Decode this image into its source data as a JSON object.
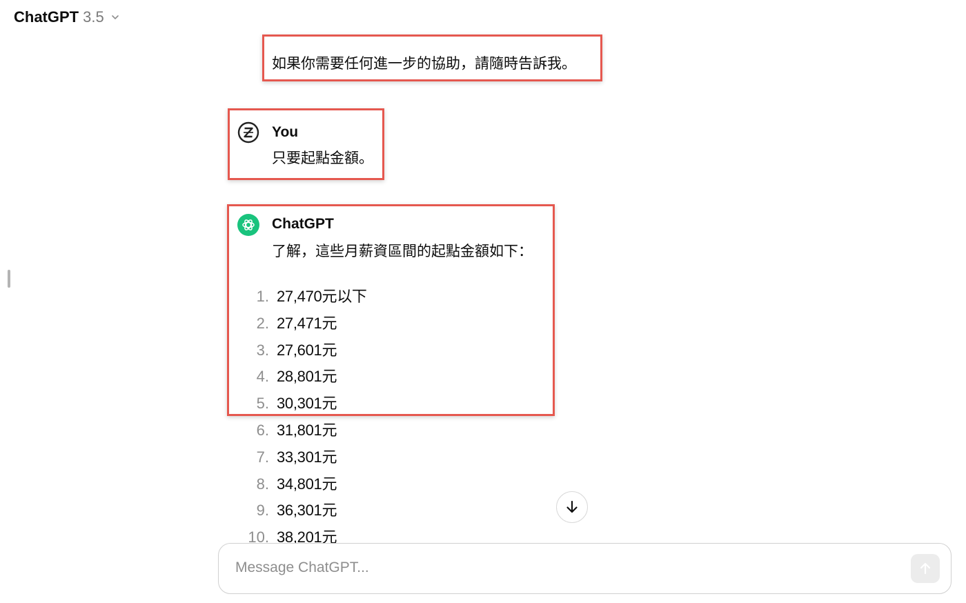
{
  "header": {
    "model_name": "ChatGPT",
    "model_version": "3.5"
  },
  "conversation": {
    "previous_message": "如果你需要任何進一步的協助，請隨時告訴我。",
    "user_turn": {
      "author": "You",
      "text": "只要起點金額。"
    },
    "assistant_turn": {
      "author": "ChatGPT",
      "intro": "了解，這些月薪資區間的起點金額如下：",
      "items": [
        {
          "num": "1.",
          "value": "27,470元以下"
        },
        {
          "num": "2.",
          "value": "27,471元"
        },
        {
          "num": "3.",
          "value": "27,601元"
        },
        {
          "num": "4.",
          "value": "28,801元"
        },
        {
          "num": "5.",
          "value": "30,301元"
        },
        {
          "num": "6.",
          "value": "31,801元"
        },
        {
          "num": "7.",
          "value": "33,301元"
        },
        {
          "num": "8.",
          "value": "34,801元"
        },
        {
          "num": "9.",
          "value": "36,301元"
        },
        {
          "num": "10.",
          "value": "38,201元"
        }
      ]
    }
  },
  "composer": {
    "placeholder": "Message ChatGPT..."
  },
  "icons": {
    "model_dropdown": "chevron-down-icon",
    "user_avatar": "user-avatar-icon",
    "assistant_avatar": "openai-logo-icon",
    "scroll": "arrow-down-icon",
    "send": "arrow-up-icon"
  },
  "colors": {
    "highlight_border": "#e5584f",
    "assistant_avatar_bg": "#19c37d",
    "list_number": "#8e8e8e"
  }
}
